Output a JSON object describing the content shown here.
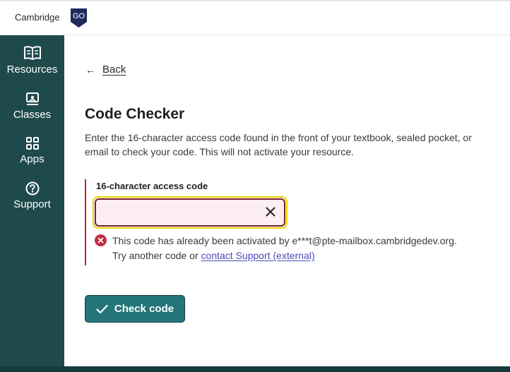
{
  "header": {
    "brand_text": "Cambridge",
    "brand_badge": "GO",
    "brand_color": "#1e2a5c"
  },
  "sidebar": {
    "background": "#1e4a4c",
    "items": [
      {
        "label": "Resources",
        "icon": "book-icon"
      },
      {
        "label": "Classes",
        "icon": "presentation-icon"
      },
      {
        "label": "Apps",
        "icon": "grid-icon"
      },
      {
        "label": "Support",
        "icon": "help-circle-icon"
      }
    ]
  },
  "main": {
    "back_label": "Back",
    "title": "Code Checker",
    "description": "Enter the 16-character access code found in the front of your textbook, sealed pocket, or email to check your code. This will not activate your resource.",
    "field": {
      "label": "16-character access code",
      "value": "",
      "placeholder": ""
    },
    "error": {
      "line1": "This code has already been activated by e***t@pte-mailbox.cambridgedev.org.",
      "line2_prefix": "Try another code or ",
      "link_text": "contact Support (external)",
      "color": "#b52a3a"
    },
    "check_button_label": "Check code",
    "button_color": "#23757a"
  }
}
